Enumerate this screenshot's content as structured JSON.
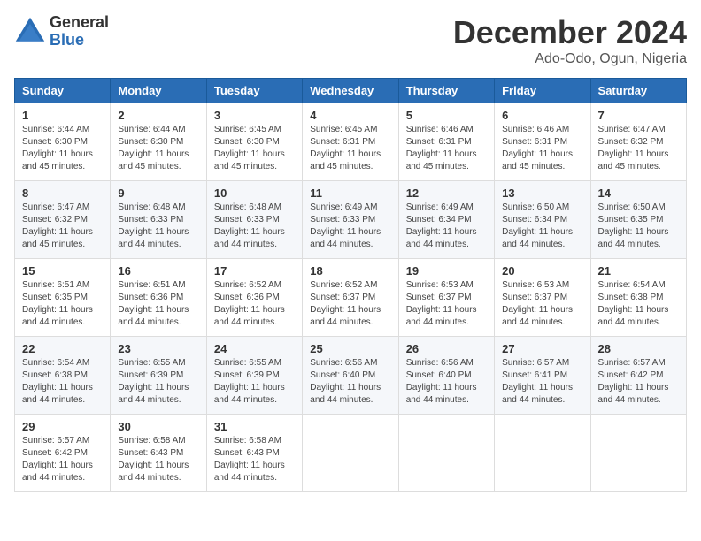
{
  "logo": {
    "general": "General",
    "blue": "Blue"
  },
  "title": "December 2024",
  "location": "Ado-Odo, Ogun, Nigeria",
  "weekdays": [
    "Sunday",
    "Monday",
    "Tuesday",
    "Wednesday",
    "Thursday",
    "Friday",
    "Saturday"
  ],
  "weeks": [
    [
      {
        "day": "1",
        "sunrise": "6:44 AM",
        "sunset": "6:30 PM",
        "daylight": "11 hours and 45 minutes."
      },
      {
        "day": "2",
        "sunrise": "6:44 AM",
        "sunset": "6:30 PM",
        "daylight": "11 hours and 45 minutes."
      },
      {
        "day": "3",
        "sunrise": "6:45 AM",
        "sunset": "6:30 PM",
        "daylight": "11 hours and 45 minutes."
      },
      {
        "day": "4",
        "sunrise": "6:45 AM",
        "sunset": "6:31 PM",
        "daylight": "11 hours and 45 minutes."
      },
      {
        "day": "5",
        "sunrise": "6:46 AM",
        "sunset": "6:31 PM",
        "daylight": "11 hours and 45 minutes."
      },
      {
        "day": "6",
        "sunrise": "6:46 AM",
        "sunset": "6:31 PM",
        "daylight": "11 hours and 45 minutes."
      },
      {
        "day": "7",
        "sunrise": "6:47 AM",
        "sunset": "6:32 PM",
        "daylight": "11 hours and 45 minutes."
      }
    ],
    [
      {
        "day": "8",
        "sunrise": "6:47 AM",
        "sunset": "6:32 PM",
        "daylight": "11 hours and 45 minutes."
      },
      {
        "day": "9",
        "sunrise": "6:48 AM",
        "sunset": "6:33 PM",
        "daylight": "11 hours and 44 minutes."
      },
      {
        "day": "10",
        "sunrise": "6:48 AM",
        "sunset": "6:33 PM",
        "daylight": "11 hours and 44 minutes."
      },
      {
        "day": "11",
        "sunrise": "6:49 AM",
        "sunset": "6:33 PM",
        "daylight": "11 hours and 44 minutes."
      },
      {
        "day": "12",
        "sunrise": "6:49 AM",
        "sunset": "6:34 PM",
        "daylight": "11 hours and 44 minutes."
      },
      {
        "day": "13",
        "sunrise": "6:50 AM",
        "sunset": "6:34 PM",
        "daylight": "11 hours and 44 minutes."
      },
      {
        "day": "14",
        "sunrise": "6:50 AM",
        "sunset": "6:35 PM",
        "daylight": "11 hours and 44 minutes."
      }
    ],
    [
      {
        "day": "15",
        "sunrise": "6:51 AM",
        "sunset": "6:35 PM",
        "daylight": "11 hours and 44 minutes."
      },
      {
        "day": "16",
        "sunrise": "6:51 AM",
        "sunset": "6:36 PM",
        "daylight": "11 hours and 44 minutes."
      },
      {
        "day": "17",
        "sunrise": "6:52 AM",
        "sunset": "6:36 PM",
        "daylight": "11 hours and 44 minutes."
      },
      {
        "day": "18",
        "sunrise": "6:52 AM",
        "sunset": "6:37 PM",
        "daylight": "11 hours and 44 minutes."
      },
      {
        "day": "19",
        "sunrise": "6:53 AM",
        "sunset": "6:37 PM",
        "daylight": "11 hours and 44 minutes."
      },
      {
        "day": "20",
        "sunrise": "6:53 AM",
        "sunset": "6:37 PM",
        "daylight": "11 hours and 44 minutes."
      },
      {
        "day": "21",
        "sunrise": "6:54 AM",
        "sunset": "6:38 PM",
        "daylight": "11 hours and 44 minutes."
      }
    ],
    [
      {
        "day": "22",
        "sunrise": "6:54 AM",
        "sunset": "6:38 PM",
        "daylight": "11 hours and 44 minutes."
      },
      {
        "day": "23",
        "sunrise": "6:55 AM",
        "sunset": "6:39 PM",
        "daylight": "11 hours and 44 minutes."
      },
      {
        "day": "24",
        "sunrise": "6:55 AM",
        "sunset": "6:39 PM",
        "daylight": "11 hours and 44 minutes."
      },
      {
        "day": "25",
        "sunrise": "6:56 AM",
        "sunset": "6:40 PM",
        "daylight": "11 hours and 44 minutes."
      },
      {
        "day": "26",
        "sunrise": "6:56 AM",
        "sunset": "6:40 PM",
        "daylight": "11 hours and 44 minutes."
      },
      {
        "day": "27",
        "sunrise": "6:57 AM",
        "sunset": "6:41 PM",
        "daylight": "11 hours and 44 minutes."
      },
      {
        "day": "28",
        "sunrise": "6:57 AM",
        "sunset": "6:42 PM",
        "daylight": "11 hours and 44 minutes."
      }
    ],
    [
      {
        "day": "29",
        "sunrise": "6:57 AM",
        "sunset": "6:42 PM",
        "daylight": "11 hours and 44 minutes."
      },
      {
        "day": "30",
        "sunrise": "6:58 AM",
        "sunset": "6:43 PM",
        "daylight": "11 hours and 44 minutes."
      },
      {
        "day": "31",
        "sunrise": "6:58 AM",
        "sunset": "6:43 PM",
        "daylight": "11 hours and 44 minutes."
      },
      null,
      null,
      null,
      null
    ]
  ]
}
